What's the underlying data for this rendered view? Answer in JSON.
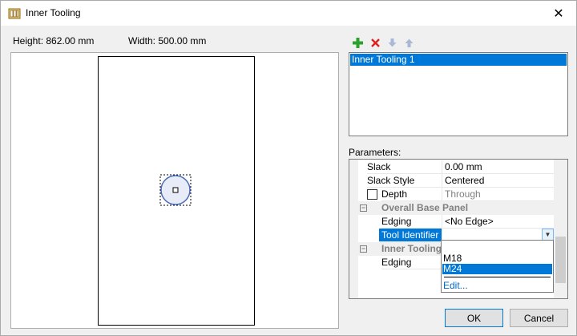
{
  "window": {
    "title": "Inner Tooling",
    "close_glyph": "✕"
  },
  "dimensions": {
    "height_label": "Height: 862.00 mm",
    "width_label": "Width: 500.00 mm"
  },
  "toolbar": {
    "add_icon": "plus-icon",
    "delete_icon": "x-icon",
    "move_down_icon": "arrow-down-icon",
    "move_up_icon": "arrow-up-icon"
  },
  "tooling_list": {
    "items": [
      "Inner Tooling 1"
    ],
    "selected_index": 0
  },
  "parameters": {
    "label": "Parameters:",
    "rows": [
      {
        "name": "Slack",
        "value": "0.00 mm"
      },
      {
        "name": "Slack Style",
        "value": "Centered"
      },
      {
        "name": "Depth",
        "value": "Through",
        "checkbox": true,
        "checked": false
      },
      {
        "category": "Overall Base Panel"
      },
      {
        "name": "Edging",
        "value": "<No Edge>"
      },
      {
        "name": "Tool Identifier",
        "value": "",
        "selected": true
      },
      {
        "category": "Inner Tooling"
      },
      {
        "name": "Edging",
        "value": ""
      }
    ]
  },
  "dropdown": {
    "options": [
      "",
      "M18",
      "M24"
    ],
    "selected": "M24",
    "edit_link": "Edit..."
  },
  "buttons": {
    "ok": "OK",
    "cancel": "Cancel"
  },
  "colors": {
    "selection": "#0078d7",
    "link": "#0066cc",
    "window_bg": "#f0f0f0"
  }
}
